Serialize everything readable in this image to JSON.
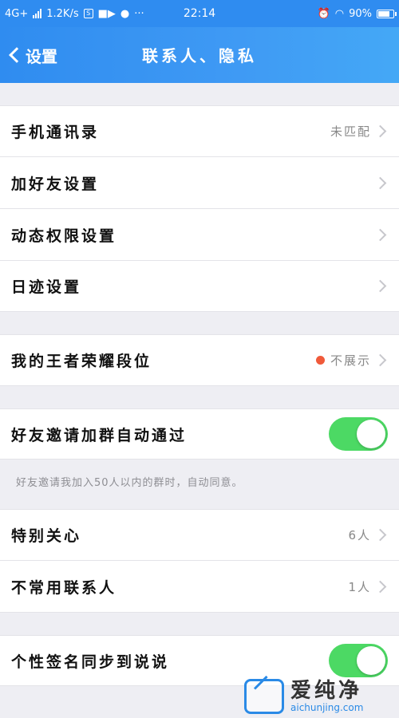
{
  "status_bar": {
    "network": "4G+",
    "speed": "1.2K/s",
    "time": "22:14",
    "battery": "90%"
  },
  "header": {
    "back_label": "设置",
    "title": "联系人、隐私"
  },
  "rows": {
    "phone_contacts": {
      "label": "手机通讯录",
      "value": "未匹配"
    },
    "add_friend": {
      "label": "加好友设置"
    },
    "feed_permissions": {
      "label": "动态权限设置"
    },
    "footprint": {
      "label": "日迹设置"
    },
    "honor_rank": {
      "label": "我的王者荣耀段位",
      "value": "不展示"
    },
    "auto_join_group": {
      "label": "好友邀请加群自动通过",
      "enabled": true
    },
    "special_care": {
      "label": "特别关心",
      "value": "6人"
    },
    "infrequent_contacts": {
      "label": "不常用联系人",
      "value": "1人"
    },
    "sync_signature": {
      "label": "个性签名同步到说说",
      "enabled": true
    }
  },
  "hint_text": "好友邀请我加入50人以内的群时，自动同意。",
  "watermark": {
    "main": "爱纯净",
    "sub": "aichunjing.com"
  },
  "colors": {
    "header_blue": "#2f8cf0",
    "toggle_green": "#4cd964",
    "badge_red": "#f05a3a",
    "background": "#eeeef3"
  }
}
